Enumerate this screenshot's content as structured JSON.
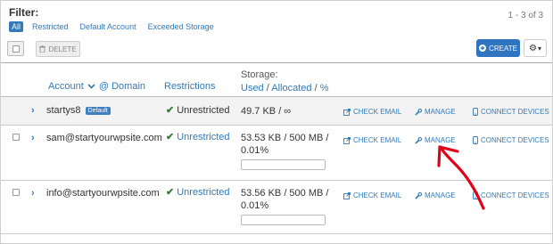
{
  "filter": {
    "title": "Filter:",
    "paging": "1 - 3 of 3",
    "chips": [
      {
        "label": "All",
        "active": true
      },
      {
        "label": "Restricted",
        "active": false
      },
      {
        "label": "Default Account",
        "active": false
      },
      {
        "label": "Exceeded Storage",
        "active": false
      }
    ]
  },
  "toolbar": {
    "delete_label": "DELETE",
    "create_label": "CREATE",
    "gear_caret": "▾"
  },
  "columns": {
    "account": "Account",
    "at_domain": "@ Domain",
    "restrictions": "Restrictions",
    "storage_title": "Storage:",
    "storage_used": "Used",
    "storage_sep1": "/",
    "storage_allocated": "Allocated",
    "storage_sep2": "/",
    "storage_pct": "%"
  },
  "rows": [
    {
      "account": "startys8",
      "badge": "Default",
      "restriction": "Unrestricted",
      "storage_line1": "49.7 KB / ∞",
      "storage_line2": "",
      "usage_fraction": null,
      "actions": {
        "check_email": "CHECK EMAIL",
        "manage": "MANAGE",
        "connect": "CONNECT DEVICES"
      }
    },
    {
      "account": "sam@startyourwpsite.com",
      "badge": "",
      "restriction": "Unrestricted",
      "storage_line1": "53.53 KB / 500 MB /",
      "storage_line2": "0.01%",
      "usage_fraction": 0.0001,
      "actions": {
        "check_email": "CHECK EMAIL",
        "manage": "MANAGE",
        "connect": "CONNECT DEVICES"
      }
    },
    {
      "account": "info@startyourwpsite.com",
      "badge": "",
      "restriction": "Unrestricted",
      "storage_line1": "53.56 KB / 500 MB /",
      "storage_line2": "0.01%",
      "usage_fraction": 0.0001,
      "actions": {
        "check_email": "CHECK EMAIL",
        "manage": "MANAGE",
        "connect": "CONNECT DEVICES"
      }
    }
  ],
  "colors": {
    "link": "#337ab7",
    "primary": "#2f74c0",
    "check": "#3c7a3c",
    "annotation": "#e0001a"
  },
  "icons": {
    "expand": "chevron-right-icon",
    "checkmark": "checkmark-icon",
    "email": "external-link-icon",
    "manage": "wrench-icon",
    "connect": "mobile-icon",
    "create": "plus-circle-icon",
    "gear": "gear-icon",
    "delete": "trash-icon"
  }
}
